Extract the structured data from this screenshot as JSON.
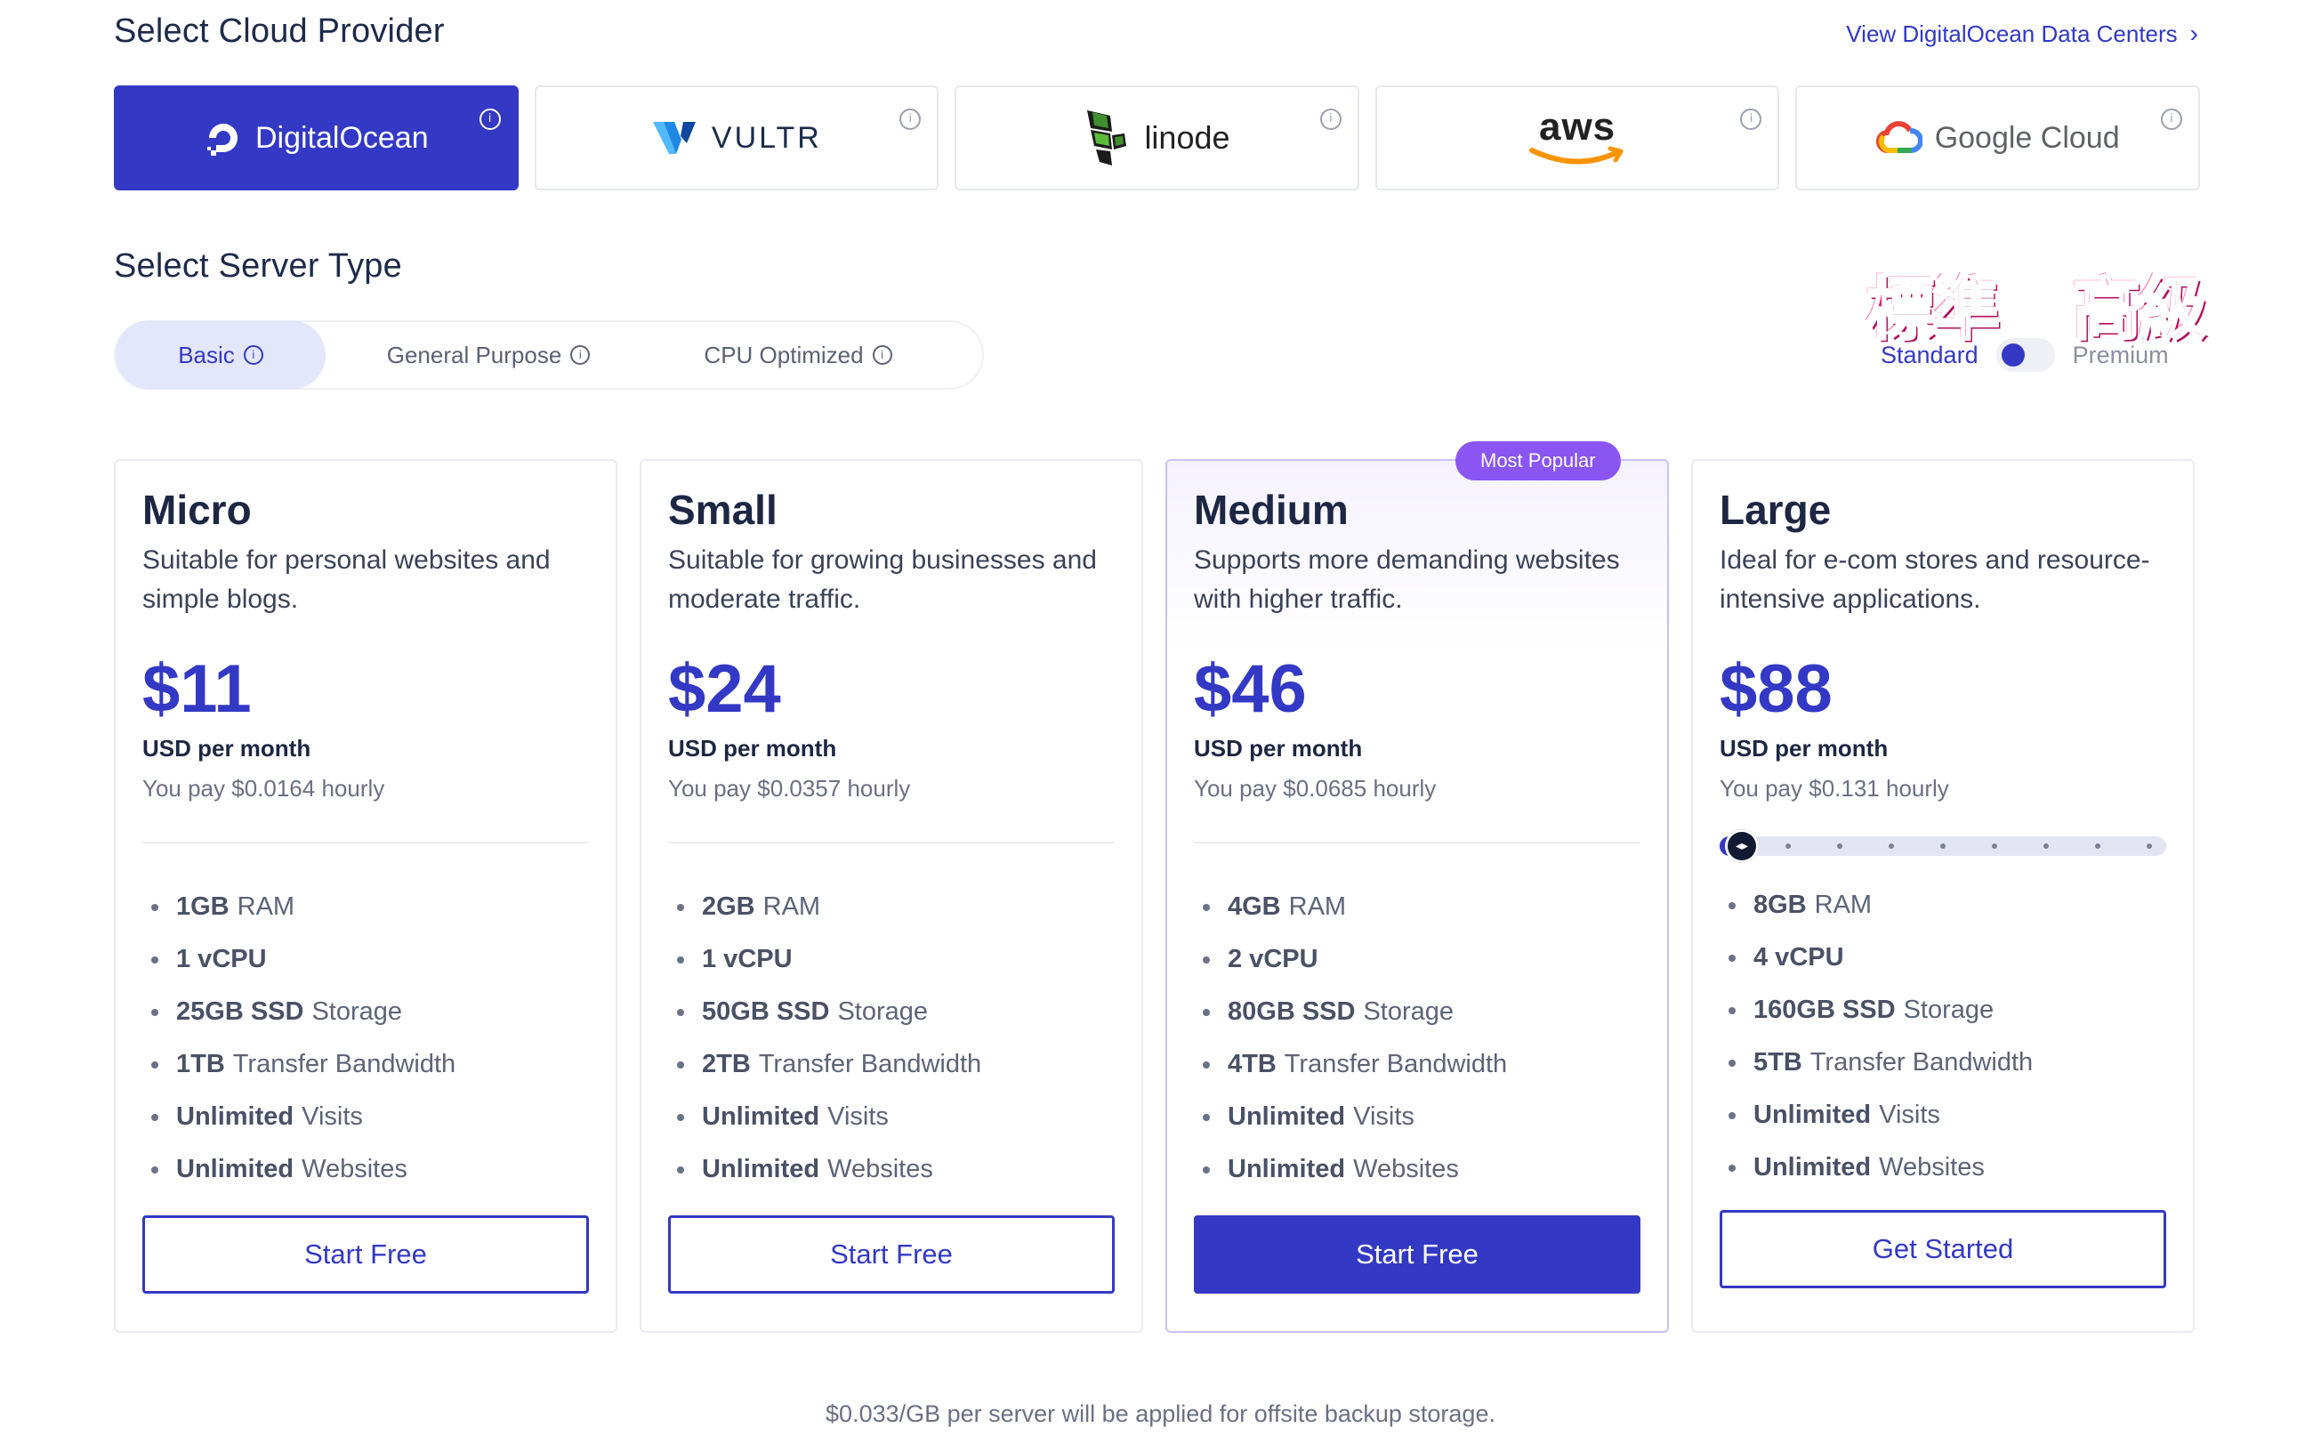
{
  "header": {
    "provider_title": "Select Cloud Provider",
    "data_centers_link": "View DigitalOcean Data Centers",
    "server_type_title": "Select Server Type"
  },
  "providers": [
    {
      "name": "DigitalOcean",
      "active": true,
      "icon": "digitalocean-logo"
    },
    {
      "name": "VULTR",
      "active": false,
      "icon": "vultr-logo"
    },
    {
      "name": "linode",
      "active": false,
      "icon": "linode-logo"
    },
    {
      "name": "aws",
      "active": false,
      "icon": "aws-logo"
    },
    {
      "name": "Google Cloud",
      "active": false,
      "icon": "google-cloud-logo"
    }
  ],
  "server_types": [
    {
      "label": "Basic",
      "active": true
    },
    {
      "label": "General Purpose",
      "active": false
    },
    {
      "label": "CPU Optimized",
      "active": false
    }
  ],
  "plan_toggle": {
    "stamp_standard": "標準",
    "stamp_premium": "高級",
    "standard_label": "Standard",
    "premium_label": "Premium",
    "selected": "Standard"
  },
  "plans": [
    {
      "name": "Micro",
      "desc": "Suitable for personal websites and simple blogs.",
      "price": "$11",
      "per": "USD per month",
      "hourly": "You pay $0.0164 hourly",
      "features": [
        {
          "strong": "1GB",
          "rest": "RAM"
        },
        {
          "strong": "1 vCPU",
          "rest": ""
        },
        {
          "strong": "25GB SSD",
          "rest": "Storage"
        },
        {
          "strong": "1TB",
          "rest": "Transfer Bandwidth"
        },
        {
          "strong": "Unlimited",
          "rest": "Visits"
        },
        {
          "strong": "Unlimited",
          "rest": "Websites"
        }
      ],
      "cta": "Start Free"
    },
    {
      "name": "Small",
      "desc": "Suitable for growing businesses and moderate traffic.",
      "price": "$24",
      "per": "USD per month",
      "hourly": "You pay $0.0357 hourly",
      "features": [
        {
          "strong": "2GB",
          "rest": "RAM"
        },
        {
          "strong": "1 vCPU",
          "rest": ""
        },
        {
          "strong": "50GB SSD",
          "rest": "Storage"
        },
        {
          "strong": "2TB",
          "rest": "Transfer Bandwidth"
        },
        {
          "strong": "Unlimited",
          "rest": "Visits"
        },
        {
          "strong": "Unlimited",
          "rest": "Websites"
        }
      ],
      "cta": "Start Free"
    },
    {
      "name": "Medium",
      "badge": "Most Popular",
      "desc": "Supports more demanding websites with higher traffic.",
      "price": "$46",
      "per": "USD per month",
      "hourly": "You pay $0.0685 hourly",
      "features": [
        {
          "strong": "4GB",
          "rest": "RAM"
        },
        {
          "strong": "2 vCPU",
          "rest": ""
        },
        {
          "strong": "80GB SSD",
          "rest": "Storage"
        },
        {
          "strong": "4TB",
          "rest": "Transfer Bandwidth"
        },
        {
          "strong": "Unlimited",
          "rest": "Visits"
        },
        {
          "strong": "Unlimited",
          "rest": "Websites"
        }
      ],
      "cta": "Start Free"
    },
    {
      "name": "Large",
      "desc": "Ideal for e-com stores and resource-intensive applications.",
      "price": "$88",
      "per": "USD per month",
      "hourly": "You pay $0.131 hourly",
      "slider": {
        "steps": 9,
        "selected_step": 1
      },
      "features": [
        {
          "strong": "8GB",
          "rest": "RAM"
        },
        {
          "strong": "4 vCPU",
          "rest": ""
        },
        {
          "strong": "160GB SSD",
          "rest": "Storage"
        },
        {
          "strong": "5TB",
          "rest": "Transfer Bandwidth"
        },
        {
          "strong": "Unlimited",
          "rest": "Visits"
        },
        {
          "strong": "Unlimited",
          "rest": "Websites"
        }
      ],
      "cta": "Get Started"
    }
  ],
  "footnote": "$0.033/GB per server will be applied for offsite backup storage.",
  "colors": {
    "accent": "#3339c4",
    "badge": "#8a55f2",
    "stamp": "#e8217a"
  }
}
